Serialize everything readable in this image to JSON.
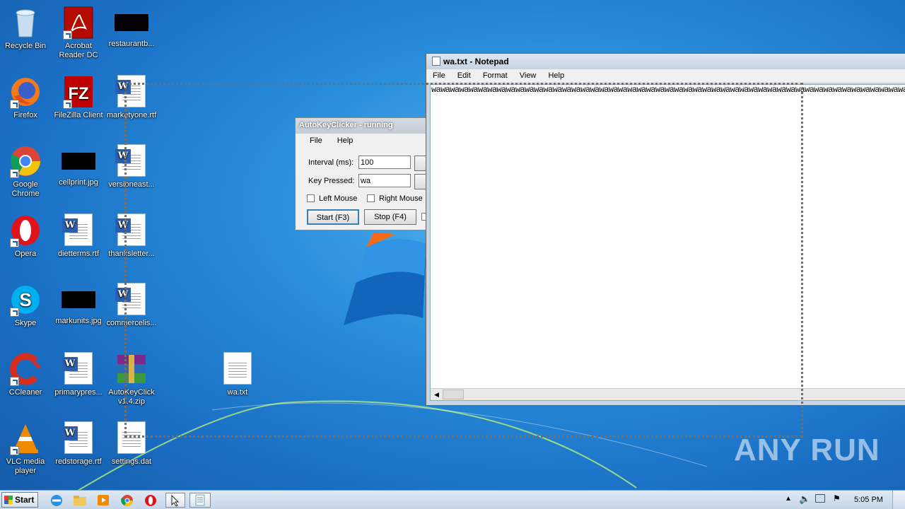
{
  "desktop": {
    "icons": [
      {
        "label": "Recycle Bin"
      },
      {
        "label": "Acrobat Reader DC"
      },
      {
        "label": "restaurantb..."
      },
      {
        "label": "Firefox"
      },
      {
        "label": "FileZilla Client"
      },
      {
        "label": "marketyone.rtf"
      },
      {
        "label": "Google Chrome"
      },
      {
        "label": "cellprint.jpg"
      },
      {
        "label": "versioneast..."
      },
      {
        "label": "Opera"
      },
      {
        "label": "dietterms.rtf"
      },
      {
        "label": "thanksletter..."
      },
      {
        "label": "Skype"
      },
      {
        "label": "markunits.jpg"
      },
      {
        "label": "commercelis..."
      },
      {
        "label": "CCleaner"
      },
      {
        "label": "primarypres..."
      },
      {
        "label": "AutoKeyClick v1.4.zip"
      },
      {
        "label": "wa.txt"
      },
      {
        "label": "VLC media player"
      },
      {
        "label": "redstorage.rtf"
      },
      {
        "label": "settings.dat"
      }
    ]
  },
  "autokeyclicker": {
    "title": "AutoKeyClicker - running",
    "menu": [
      "File",
      "Help"
    ],
    "interval_label": "Interval (ms):",
    "interval_value": "100",
    "key_label": "Key Pressed:",
    "key_value": "wa",
    "left_mouse": "Left Mouse",
    "right_mouse": "Right Mouse",
    "start_button": "Start (F3)",
    "stop_button": "Stop (F4)"
  },
  "notepad": {
    "title": "wa.txt - Notepad",
    "menu": [
      "File",
      "Edit",
      "Format",
      "View",
      "Help"
    ],
    "content": "wawawawawawawawawawawawawawawawawawawawawawawawawawawawawawawawawawawawawawawawawawawawawawawawawawawawawawawa"
  },
  "watermark": "ANY RUN",
  "taskbar": {
    "start_label": "Start",
    "clock": "5:05 PM"
  },
  "colors": {
    "desktop_bg": "#1a6fc4",
    "window_frame": "#c9d6e6"
  }
}
